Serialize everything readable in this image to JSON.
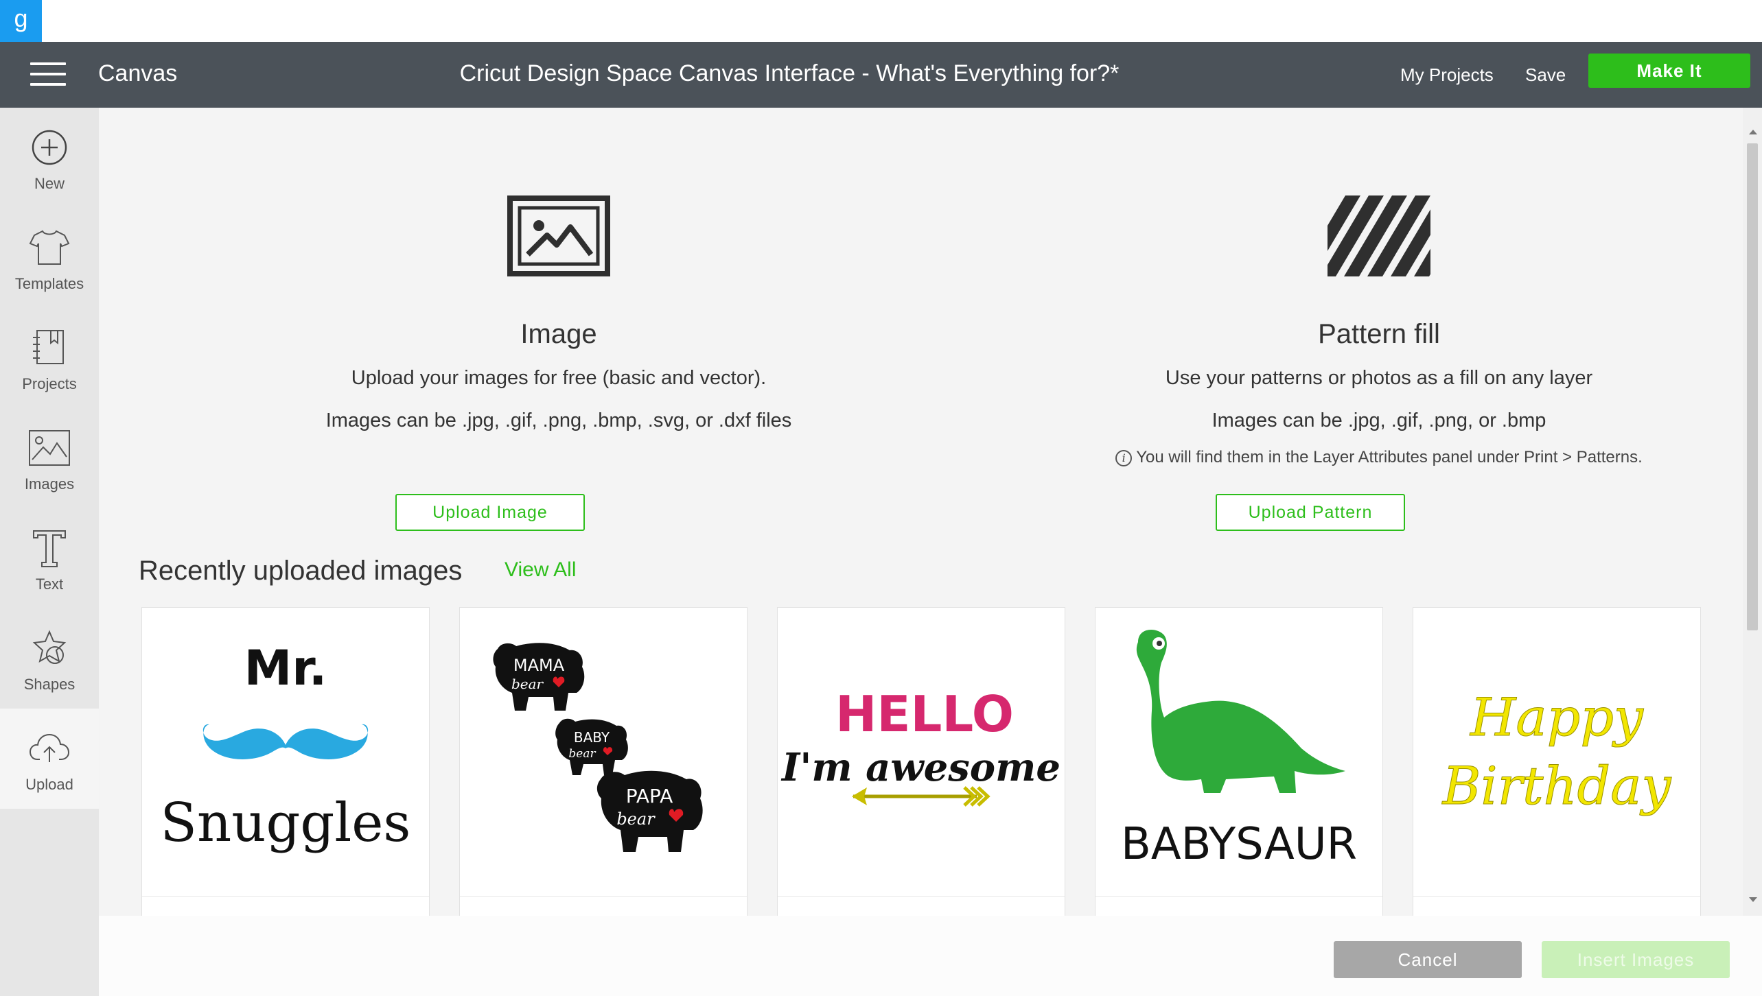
{
  "browser": {
    "badge": "g"
  },
  "header": {
    "app_label": "Canvas",
    "title": "Cricut Design Space Canvas Interface - What's Everything for?*",
    "my_projects": "My Projects",
    "save": "Save",
    "make_it": "Make It"
  },
  "sidebar": {
    "items": [
      {
        "label": "New",
        "icon": "plus-circle-icon"
      },
      {
        "label": "Templates",
        "icon": "tshirt-icon"
      },
      {
        "label": "Projects",
        "icon": "book-icon"
      },
      {
        "label": "Images",
        "icon": "picture-icon"
      },
      {
        "label": "Text",
        "icon": "text-t-icon"
      },
      {
        "label": "Shapes",
        "icon": "shapes-icon"
      },
      {
        "label": "Upload",
        "icon": "cloud-upload-icon"
      }
    ],
    "active": "Upload"
  },
  "upload": {
    "image": {
      "title": "Image",
      "description": "Upload your images for free (basic and vector).",
      "formats": "Images can be .jpg, .gif, .png, .bmp, .svg, or .dxf files",
      "button": "Upload Image"
    },
    "pattern": {
      "title": "Pattern fill",
      "description": "Use your patterns or photos as a fill on any layer",
      "formats": "Images can be .jpg, .gif, .png, or .bmp",
      "info_icon": "i",
      "info": "You will find them in the Layer Attributes panel under Print > Patterns.",
      "button": "Upload Pattern"
    }
  },
  "recent": {
    "title": "Recently uploaded images",
    "view_all": "View All",
    "cards": [
      {
        "line1": "Mr.",
        "line2": "Snuggles"
      },
      {
        "mama": "MAMA",
        "baby": "BABY",
        "papa": "PAPA",
        "bear": "bear"
      },
      {
        "line1": "HELLO",
        "line2": "I'm awesome"
      },
      {
        "text": "BABYSAUR"
      },
      {
        "line1": "Happy",
        "line2": "Birthday"
      }
    ]
  },
  "footer": {
    "cancel": "Cancel",
    "insert": "Insert Images"
  },
  "colors": {
    "accent": "#2dbe1b",
    "header_bg": "#4b5259",
    "sidebar_bg": "#e6e6e6",
    "main_bg": "#f4f4f4",
    "mustache_blue": "#29a9e0",
    "hello_pink": "#d6286e",
    "dino_green": "#2eaa3a",
    "birthday_yellow": "#f2e600"
  }
}
